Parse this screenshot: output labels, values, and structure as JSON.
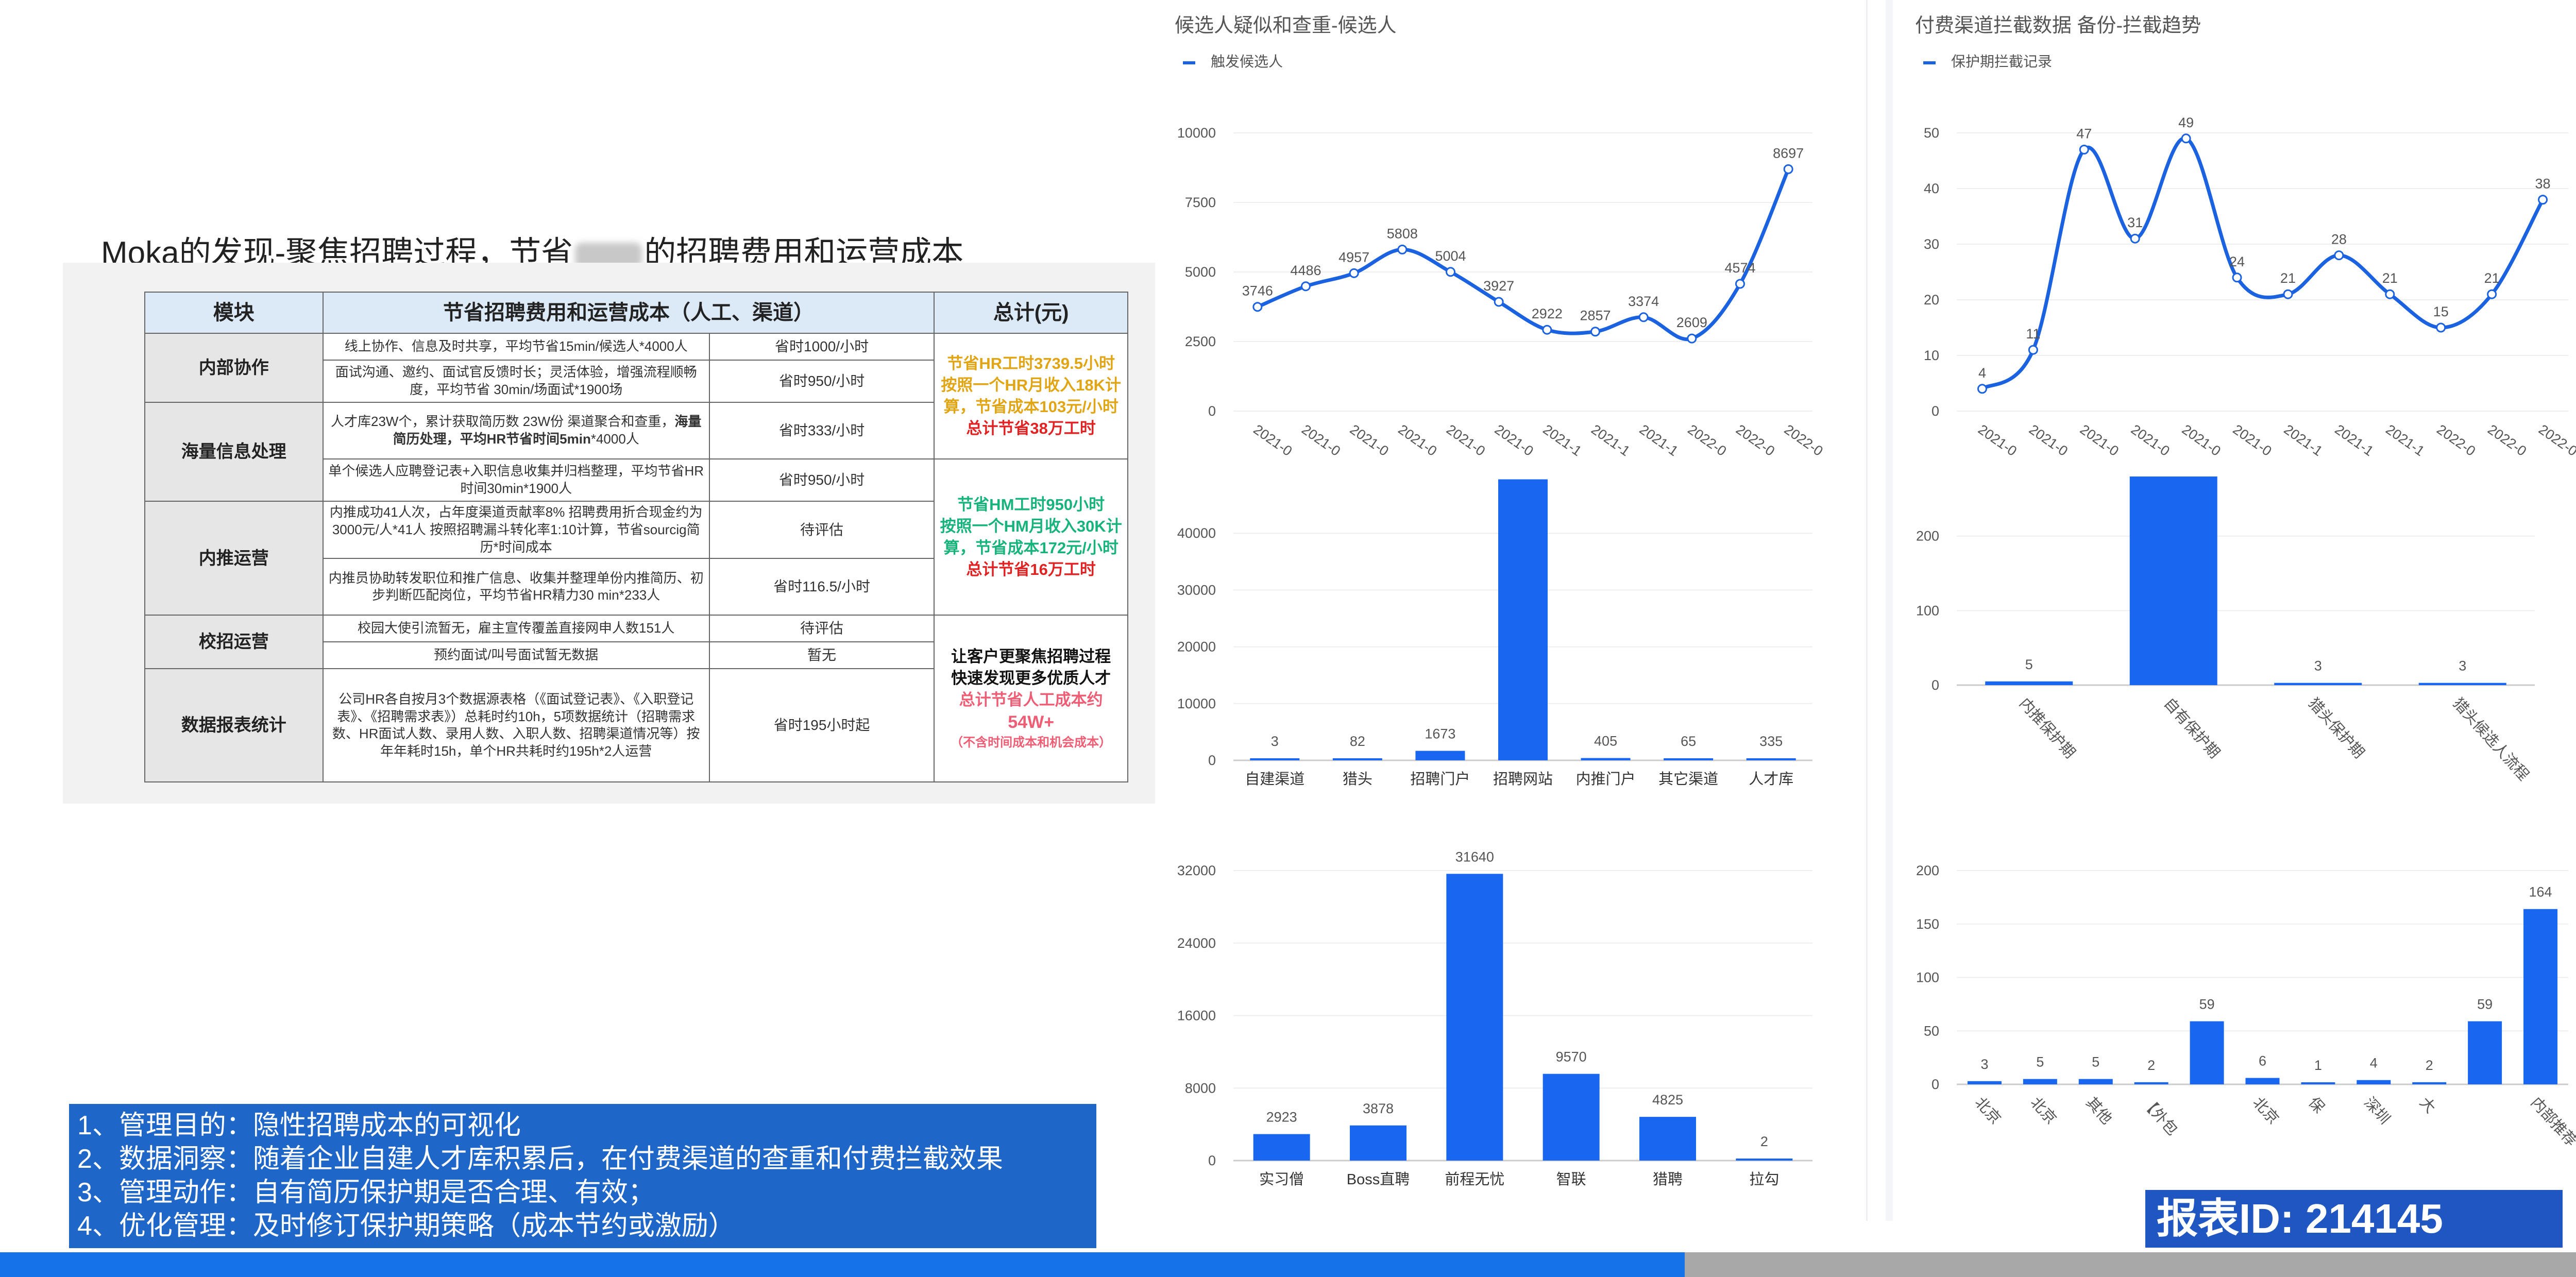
{
  "left": {
    "title_prefix": "Moka的发现-聚焦招聘过程，节省",
    "title_suffix": "的招聘费用和运营成本",
    "table": {
      "headers": [
        "模块",
        "节省招聘费用和运营成本（人工、渠道）",
        "总计(元)"
      ],
      "modules": [
        "内部协作",
        "海量信息处理",
        "内推运营",
        "校招运营",
        "数据报表统计"
      ],
      "rows": [
        {
          "desc": "线上协作、信息及时共享，平均节省15min/候选人*4000人",
          "saving": "省时1000/小时"
        },
        {
          "desc": "面试沟通、邀约、面试官反馈时长；灵活体验，增强流程顺畅度，平均节省 30min/场面试*1900场",
          "saving": "省时950/小时"
        },
        {
          "desc_a": "人才库23W个，累计获取简历数 23W份 渠道聚合和查重，",
          "desc_b": "海量简历处理，平均HR节省时间5min",
          "desc_c": "*4000人",
          "saving": "省时333/小时"
        },
        {
          "desc": "单个候选人应聘登记表+入职信息收集并归档整理，平均节省HR时间30min*1900人",
          "saving": "省时950/小时"
        },
        {
          "desc": "内推成功41人次，占年度渠道贡献率8% 招聘费用折合现金约为3000元/人*41人 按照招聘漏斗转化率1:10计算，节省sourcig简历*时间成本",
          "saving": "待评估"
        },
        {
          "desc": "内推员协助转发职位和推广信息、收集并整理单份内推简历、初步判断匹配岗位，平均节省HR精力30 min*233人",
          "saving": "省时116.5/小时"
        },
        {
          "desc": "校园大使引流暂无，雇主宣传覆盖直接网申人数151人",
          "saving": "待评估"
        },
        {
          "desc": "预约面试/叫号面试暂无数据",
          "saving": "暂无"
        },
        {
          "desc": "公司HR各自按月3个数据源表格（《面试登记表》、《入职登记表》、《招聘需求表》）总耗时约10h，5项数据统计（招聘需求数、HR面试人数、录用人数、入职人数、招聘渠道情况等）按年年耗时15h，单个HR共耗时约195h*2人运营",
          "saving": "省时195小时起"
        }
      ],
      "totals": {
        "hr_1": "节省HR工时3739.5小时",
        "hr_2": "按照一个HR月收入18K计",
        "hr_3": "算，节省成本103元/小时",
        "hr_4": "总计节省38万工时",
        "hm_1": "节省HM工时950小时",
        "hm_2": "按照一个HM月收入30K计",
        "hm_3": "算，节省成本172元/小时",
        "hm_4": "总计节省16万工时",
        "c_1": "让客户更聚焦招聘过程",
        "c_2": "快速发现更多优质人才",
        "c_3": "总计节省人工成本约",
        "c_4": "54W+",
        "c_5": "（不含时间成本和机会成本）"
      }
    },
    "purpose": [
      "1、管理目的：隐性招聘成本的可视化",
      "2、数据洞察：随着企业自建人才库积累后，在付费渠道的查重和付费拦截效果",
      "3、管理动作：自有简历保护期是否合理、有效；",
      "4、优化管理：及时修订保护期策略（成本节约或激励）"
    ]
  },
  "panels": {
    "left_title": "候选人疑似和查重-候选人",
    "left_legend": "触发候选人",
    "right_title": "付费渠道拦截数据 备份-拦截趋势",
    "right_legend": "保护期拦截记录"
  },
  "report_id": "报表ID: 214145",
  "colors": {
    "accent": "#1a62e0",
    "bar": "#1967f0",
    "banner": "#1f66c9"
  },
  "chart_data": [
    {
      "type": "line",
      "title": "候选人疑似和查重-候选人",
      "series": [
        {
          "name": "触发候选人",
          "values": [
            3746,
            4486,
            4957,
            5808,
            5004,
            3927,
            2922,
            2857,
            3374,
            2609,
            4574,
            8697
          ]
        }
      ],
      "x": [
        "2021-0",
        "2021-0",
        "2021-0",
        "2021-0",
        "2021-0",
        "2021-0",
        "2021-1",
        "2021-1",
        "2021-1",
        "2022-0",
        "2022-0",
        "2022-0"
      ],
      "yticks": [
        0,
        2500,
        5000,
        7500,
        10000
      ],
      "ylim": [
        0,
        10000
      ]
    },
    {
      "type": "line",
      "title": "付费渠道拦截数据 备份-拦截趋势",
      "series": [
        {
          "name": "保护期拦截记录",
          "values": [
            4,
            11,
            47,
            31,
            49,
            24,
            21,
            28,
            21,
            15,
            21,
            38
          ]
        }
      ],
      "x": [
        "2021-0",
        "2021-0",
        "2021-0",
        "2021-0",
        "2021-0",
        "2021-0",
        "2021-1",
        "2021-1",
        "2021-1",
        "2022-0",
        "2022-0",
        "2022-0"
      ],
      "yticks": [
        0,
        10,
        20,
        30,
        40,
        50
      ],
      "ylim": [
        0,
        50
      ]
    },
    {
      "type": "bar",
      "categories": [
        "自建渠道",
        "猎头",
        "招聘门户",
        "招聘网站",
        "内推门户",
        "其它渠道",
        "人才库"
      ],
      "values": [
        3,
        82,
        1673,
        49500,
        405,
        65,
        335
      ],
      "labels": [
        "3",
        "82",
        "1673",
        "",
        "405",
        "65",
        "335"
      ],
      "yticks": [
        0,
        10000,
        20000,
        30000,
        40000
      ],
      "ylim": [
        0,
        50000
      ]
    },
    {
      "type": "bar",
      "categories": [
        "内推保护期",
        "自有保护期",
        "猎头保护期",
        "猎头候选人流程"
      ],
      "values": [
        5,
        280,
        3,
        3
      ],
      "labels": [
        "5",
        "",
        "3",
        "3"
      ],
      "yticks": [
        0,
        100,
        200
      ],
      "ylim": [
        0,
        280
      ]
    },
    {
      "type": "bar",
      "categories": [
        "实习僧",
        "Boss直聘",
        "前程无忧",
        "智联",
        "猎聘",
        "拉勾"
      ],
      "values": [
        2923,
        3878,
        31640,
        9570,
        4825,
        2
      ],
      "labels": [
        "2923",
        "3878",
        "31640",
        "9570",
        "4825",
        "2"
      ],
      "yticks": [
        0,
        8000,
        16000,
        24000,
        32000
      ],
      "ylim": [
        0,
        32000
      ]
    },
    {
      "type": "bar",
      "categories": [
        "北京",
        "北京",
        "其他",
        "【外包",
        "",
        "北京",
        "保",
        "深圳",
        "大",
        "",
        "内部推荐"
      ],
      "values": [
        3,
        5,
        5,
        2,
        59,
        6,
        1,
        4,
        2,
        59,
        164
      ],
      "labels": [
        "3",
        "5",
        "5",
        "2",
        "59",
        "6",
        "1",
        "4",
        "2",
        "59",
        "164"
      ],
      "yticks": [
        0,
        50,
        100,
        150,
        200
      ],
      "ylim": [
        0,
        200
      ]
    }
  ]
}
